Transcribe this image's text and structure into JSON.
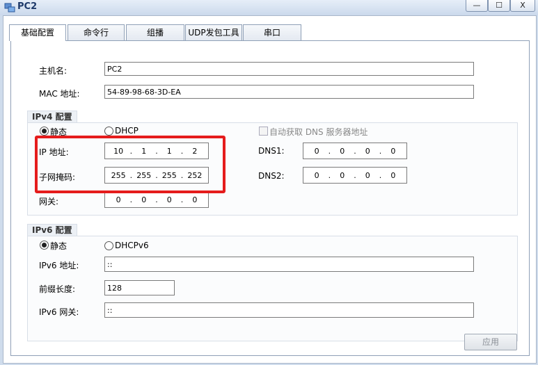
{
  "window": {
    "title": "PC2",
    "min_label": "—",
    "max_label": "☐",
    "close_label": "X"
  },
  "tabs": [
    "基础配置",
    "命令行",
    "组播",
    "UDP发包工具",
    "串口"
  ],
  "basic": {
    "hostname_label": "主机名:",
    "hostname_value": "PC2",
    "mac_label": "MAC 地址:",
    "mac_value": "54-89-98-68-3D-EA"
  },
  "ipv4": {
    "group_title": "IPv4 配置",
    "static_label": "静态",
    "dhcp_label": "DHCP",
    "auto_dns_label": "自动获取 DNS 服务器地址",
    "ip_label": "IP 地址:",
    "ip": [
      "10",
      "1",
      "1",
      "2"
    ],
    "mask_label": "子网掩码:",
    "mask": [
      "255",
      "255",
      "255",
      "252"
    ],
    "gateway_label": "网关:",
    "gateway": [
      "0",
      "0",
      "0",
      "0"
    ],
    "dns1_label": "DNS1:",
    "dns1": [
      "0",
      "0",
      "0",
      "0"
    ],
    "dns2_label": "DNS2:",
    "dns2": [
      "0",
      "0",
      "0",
      "0"
    ],
    "mode_selected": "static"
  },
  "ipv6": {
    "group_title": "IPv6 配置",
    "static_label": "静态",
    "dhcp_label": "DHCPv6",
    "addr_label": "IPv6 地址:",
    "addr_value": "::",
    "prefix_label": "前缀长度:",
    "prefix_value": "128",
    "gateway_label": "IPv6 网关:",
    "gateway_value": "::",
    "mode_selected": "static"
  },
  "apply_label": "应用",
  "colors": {
    "highlight": "#e51c1c",
    "title": "#1e3a6a"
  }
}
